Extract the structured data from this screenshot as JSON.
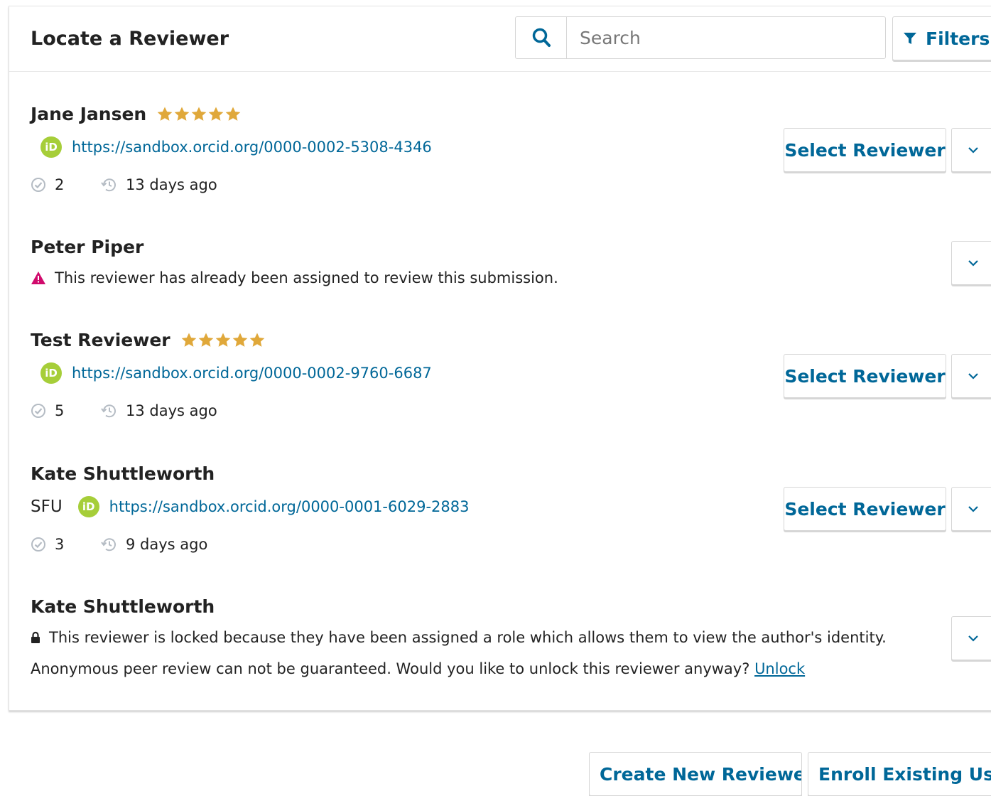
{
  "header": {
    "title": "Locate a Reviewer",
    "search_placeholder": "Search",
    "filters_label": "Filters"
  },
  "reviewers": [
    {
      "name": "Jane Jansen",
      "rating": 5,
      "orcid": "https://sandbox.orcid.org/0000-0002-5308-4346",
      "completed": "2",
      "last_activity": "13 days ago",
      "select_label": "Select Reviewer"
    },
    {
      "name": "Peter Piper",
      "notice": "This reviewer has already been assigned to review this submission."
    },
    {
      "name": "Test Reviewer",
      "rating": 5,
      "orcid": "https://sandbox.orcid.org/0000-0002-9760-6687",
      "completed": "5",
      "last_activity": "13 days ago",
      "select_label": "Select Reviewer"
    },
    {
      "name": "Kate Shuttleworth",
      "affiliation": "SFU",
      "orcid": "https://sandbox.orcid.org/0000-0001-6029-2883",
      "completed": "3",
      "last_activity": "9 days ago",
      "select_label": "Select Reviewer"
    },
    {
      "name": "Kate Shuttleworth",
      "locked_notice": "This reviewer is locked because they have been assigned a role which allows them to view the author's identity.",
      "unlock_prompt": "Anonymous peer review can not be guaranteed. Would you like to unlock this reviewer anyway?",
      "unlock_label": "Unlock"
    }
  ],
  "orcid_badge_text": "iD",
  "footer": {
    "create_label": "Create New Reviewer",
    "enroll_label": "Enroll Existing User"
  },
  "colors": {
    "link": "#006798",
    "star": "#e0a83a",
    "warning": "#d00a6c",
    "orcid": "#a6ce39"
  }
}
